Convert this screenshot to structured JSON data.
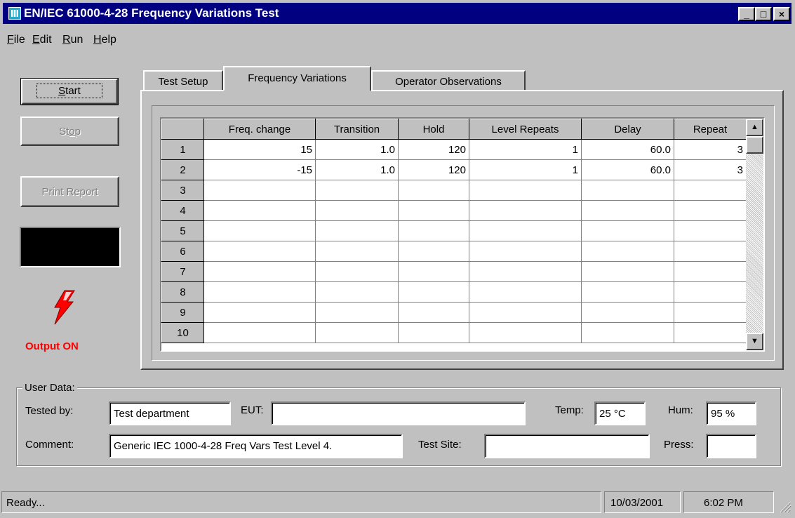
{
  "window": {
    "title": "EN/IEC 61000-4-28 Frequency Variations Test",
    "controls": [
      "_",
      "□",
      "×"
    ]
  },
  "menu": [
    {
      "label": "File",
      "hot": "F",
      "rest": "ile"
    },
    {
      "label": "Edit",
      "hot": "E",
      "rest": "dit"
    },
    {
      "label": "Run",
      "hot": "R",
      "rest": "un"
    },
    {
      "label": "Help",
      "hot": "H",
      "rest": "elp"
    }
  ],
  "left_panel": {
    "start": {
      "hot": "S",
      "rest": "tart"
    },
    "stop": {
      "pre": "St",
      "hot": "o",
      "rest": "p"
    },
    "print_report": "Print Report",
    "output_status": "Output ON",
    "output_icon": "lightning-bolt-icon",
    "output_color": "#ff0000"
  },
  "tabs": [
    "Test Setup",
    "Frequency Variations",
    "Operator Observations"
  ],
  "active_tab": "Frequency Variations",
  "grid": {
    "columns": [
      "",
      "Freq. change",
      "Transition",
      "Hold",
      "Level Repeats",
      "Delay",
      "Repeat"
    ],
    "rows": [
      {
        "n": "1",
        "freq": "15",
        "transition": "1.0",
        "hold": "120",
        "level_repeats": "1",
        "delay": "60.0",
        "repeat": "3"
      },
      {
        "n": "2",
        "freq": "-15",
        "transition": "1.0",
        "hold": "120",
        "level_repeats": "1",
        "delay": "60.0",
        "repeat": "3"
      },
      {
        "n": "3",
        "freq": "",
        "transition": "",
        "hold": "",
        "level_repeats": "",
        "delay": "",
        "repeat": ""
      },
      {
        "n": "4",
        "freq": "",
        "transition": "",
        "hold": "",
        "level_repeats": "",
        "delay": "",
        "repeat": ""
      },
      {
        "n": "5",
        "freq": "",
        "transition": "",
        "hold": "",
        "level_repeats": "",
        "delay": "",
        "repeat": ""
      },
      {
        "n": "6",
        "freq": "",
        "transition": "",
        "hold": "",
        "level_repeats": "",
        "delay": "",
        "repeat": ""
      },
      {
        "n": "7",
        "freq": "",
        "transition": "",
        "hold": "",
        "level_repeats": "",
        "delay": "",
        "repeat": ""
      },
      {
        "n": "8",
        "freq": "",
        "transition": "",
        "hold": "",
        "level_repeats": "",
        "delay": "",
        "repeat": ""
      },
      {
        "n": "9",
        "freq": "",
        "transition": "",
        "hold": "",
        "level_repeats": "",
        "delay": "",
        "repeat": ""
      },
      {
        "n": "10",
        "freq": "",
        "transition": "",
        "hold": "",
        "level_repeats": "",
        "delay": "",
        "repeat": ""
      }
    ]
  },
  "user_data": {
    "group_label": "User Data:",
    "tested_by_label": "Tested by:",
    "tested_by_value": "Test department",
    "eut_label": "EUT:",
    "eut_value": "",
    "temp_label": "Temp:",
    "temp_value": "25 °C",
    "hum_label": "Hum:",
    "hum_value": "95 %",
    "comment_label": "Comment:",
    "comment_value": "Generic IEC 1000-4-28 Freq Vars Test Level 4.",
    "test_site_label": "Test Site:",
    "test_site_value": "",
    "press_label": "Press:",
    "press_value": ""
  },
  "status_bar": {
    "message": "Ready...",
    "date": "10/03/2001",
    "time": "6:02 PM"
  }
}
